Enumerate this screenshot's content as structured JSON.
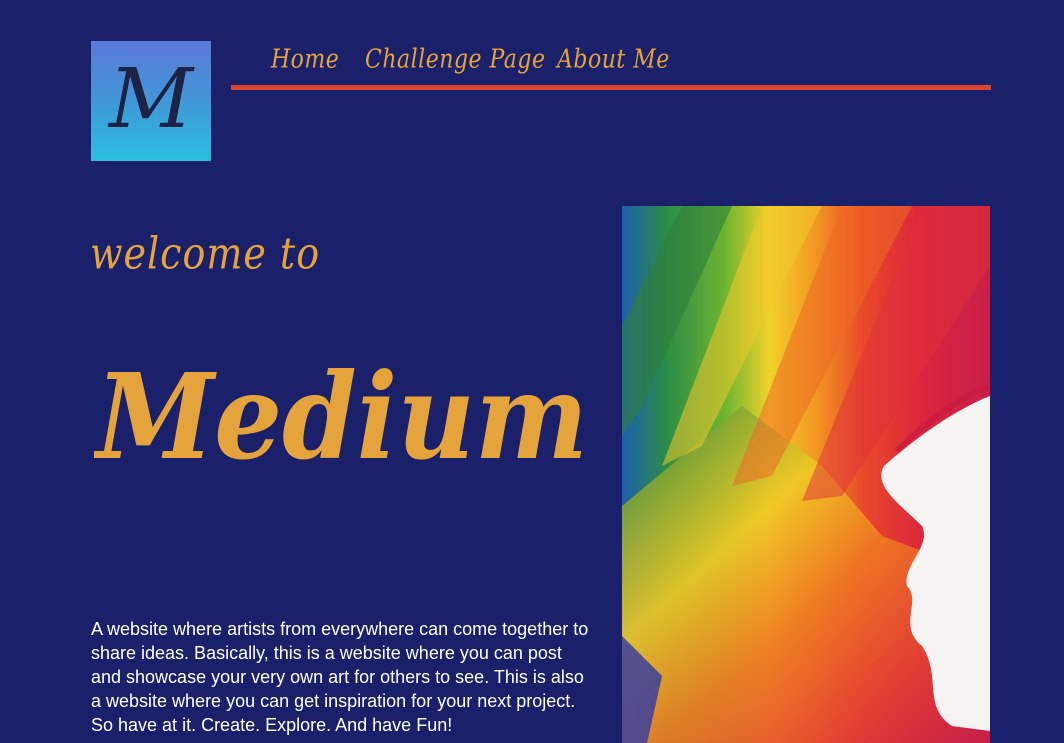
{
  "logo": {
    "letter": "M",
    "icon": "logo-monogram"
  },
  "nav": {
    "items": [
      {
        "label": "Home"
      },
      {
        "label": "Challenge Page"
      },
      {
        "label": "About Me"
      }
    ]
  },
  "hero": {
    "welcome": "welcome to",
    "brand": "Medium",
    "description": "A website where artists from everywhere can come together to share ideas. Basically, this is a website where you can post and showcase your very own art for others to see. This is also a website where you can get inspiration for your next project. So have at it. Create. Explore. And have Fun!",
    "image_icon": "rainbow-paint-stroke-image"
  },
  "colors": {
    "background": "#1b206a",
    "accent_gold": "#e5a43b",
    "nav_underline": "#d8452e",
    "text": "#ffffff"
  }
}
